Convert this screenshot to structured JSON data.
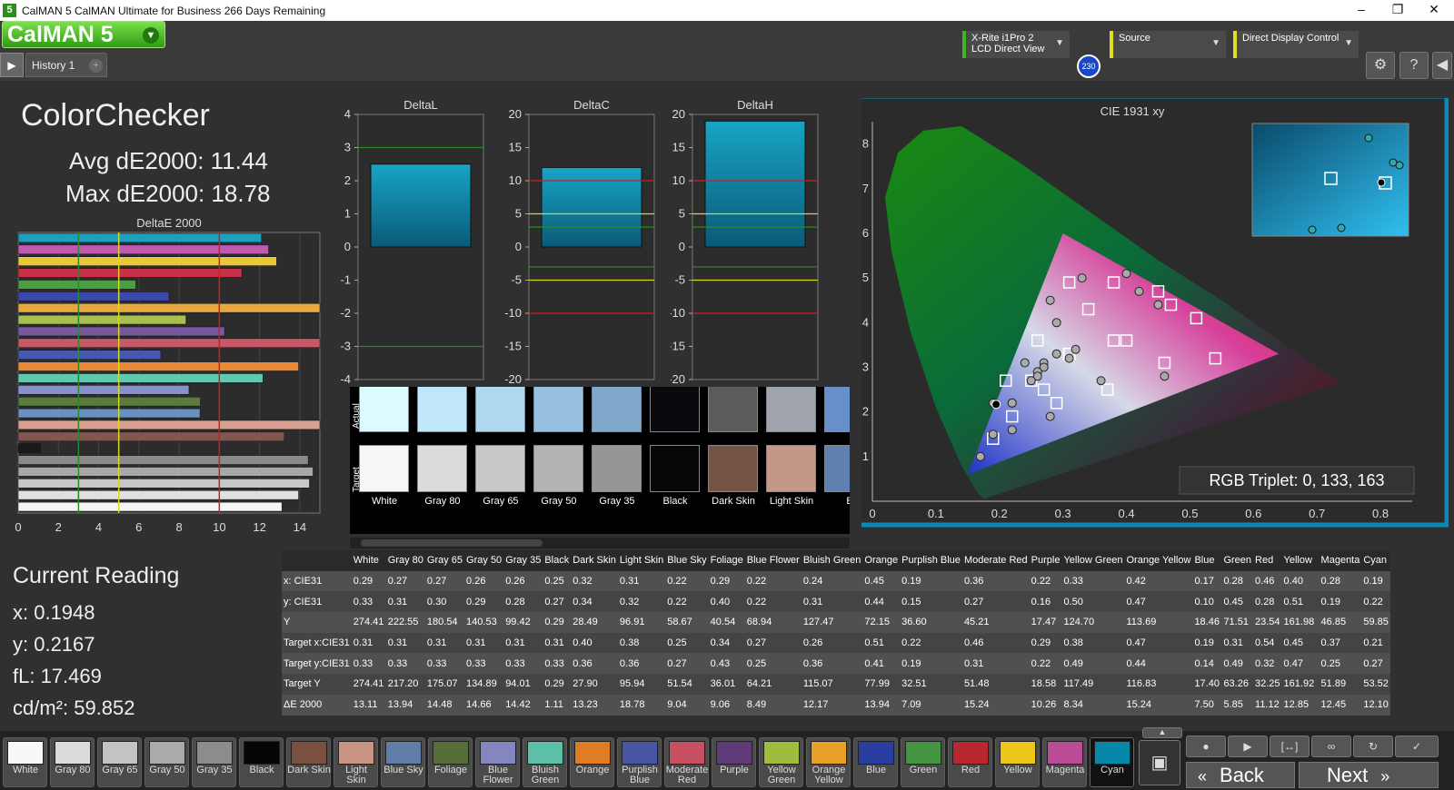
{
  "window": {
    "title": "CalMAN 5 CalMAN Ultimate for Business 266 Days Remaining",
    "icon_label": "5",
    "minimize": "–",
    "maximize": "❐",
    "close": "✕"
  },
  "header": {
    "logo": "CalMAN 5",
    "history_tab": "History 1",
    "meter_line1": "X-Rite i1Pro 2",
    "meter_line2": "LCD Direct View",
    "meter_badge": "230",
    "source": "Source",
    "display": "Direct Display Control",
    "colors": {
      "accent_green": "#3fb51f",
      "status_yellow": "#dede1e",
      "badge_blue": "#1848c8"
    }
  },
  "summary": {
    "title": "ColorChecker",
    "avg": "Avg dE2000: 11.44",
    "max": "Max dE2000: 18.78"
  },
  "current": {
    "title": "Current Reading",
    "x": "x: 0.1948",
    "y": "y: 0.2167",
    "fl": "fL: 17.469",
    "cd": "cd/m²: 59.852"
  },
  "chart_data": [
    {
      "type": "bar",
      "title": "DeltaE 2000",
      "orientation": "horizontal",
      "xlim": [
        0,
        15
      ],
      "xticks": [
        "0",
        "2",
        "4",
        "6",
        "8",
        "10",
        "12",
        "14"
      ],
      "thresholds": [
        {
          "value": 3,
          "color": "#2a8a2a"
        },
        {
          "value": 5,
          "color": "#d8d820"
        },
        {
          "value": 10,
          "color": "#c82020"
        }
      ],
      "categories": [
        "Cyan",
        "Magenta",
        "Yellow",
        "Red",
        "Green",
        "Blue",
        "Yellow Orange",
        "Yellow Green",
        "Purple",
        "Moderate Red",
        "Purplish Blue",
        "Orange",
        "Bluish Green",
        "Blue Flower",
        "Foliage",
        "Blue Sky",
        "Light Skin",
        "Dark Skin",
        "Black",
        "Gray 35",
        "Gray 50",
        "Gray 65",
        "Gray 80",
        "White"
      ],
      "values": [
        12.1,
        12.45,
        12.85,
        11.12,
        5.85,
        7.5,
        15.24,
        8.34,
        10.26,
        15.24,
        7.09,
        13.94,
        12.17,
        8.49,
        9.06,
        9.04,
        18.78,
        13.23,
        1.11,
        14.42,
        14.66,
        14.48,
        13.94,
        13.11
      ],
      "colors": [
        "#1aa0c0",
        "#c05ab0",
        "#e8c83a",
        "#c83048",
        "#4aa040",
        "#3a48a8",
        "#e8a840",
        "#a8c050",
        "#7a58a0",
        "#c85868",
        "#4858b0",
        "#e88838",
        "#60c8b0",
        "#8890d0",
        "#5a7a40",
        "#6890c0",
        "#d8a090",
        "#805850",
        "#1a1a1a",
        "#8a8a8a",
        "#a8a8a8",
        "#c8c8c8",
        "#e0e0e0",
        "#f5f5f5"
      ]
    },
    {
      "type": "bar",
      "title": "DeltaL",
      "ylim": [
        -4,
        4
      ],
      "yticks": [
        "4",
        "3",
        "2",
        "1",
        "0",
        "-1",
        "-2",
        "-3",
        "-4"
      ],
      "value": 2.5,
      "thresholds": [
        3,
        -3
      ]
    },
    {
      "type": "bar",
      "title": "DeltaC",
      "ylim": [
        -20,
        20
      ],
      "yticks": [
        "20",
        "15",
        "10",
        "5",
        "0",
        "-5",
        "-10",
        "-15",
        "-20"
      ],
      "value": 12,
      "thresholds": [
        10,
        5,
        3,
        -3,
        -5,
        -10
      ]
    },
    {
      "type": "bar",
      "title": "DeltaH",
      "ylim": [
        -20,
        20
      ],
      "yticks": [
        "20",
        "15",
        "10",
        "5",
        "0",
        "-5",
        "-10",
        "-15",
        "-20"
      ],
      "value": 19,
      "thresholds": [
        10,
        5,
        3,
        -3,
        -5,
        -10
      ]
    },
    {
      "type": "scatter",
      "title": "CIE 1931 xy",
      "xlim": [
        0,
        0.85
      ],
      "ylim": [
        0,
        0.85
      ],
      "xticks": [
        "0",
        "0.1",
        "0.2",
        "0.3",
        "0.4",
        "0.5",
        "0.6",
        "0.7",
        "0.8"
      ],
      "yticks": [
        "0",
        "0.1",
        "0.2",
        "0.3",
        "0.4",
        "0.5",
        "0.6",
        "0.7",
        "0.8"
      ],
      "gamut": [
        [
          0.64,
          0.33
        ],
        [
          0.3,
          0.6
        ],
        [
          0.15,
          0.06
        ]
      ],
      "actual_x": [
        0.29,
        0.27,
        0.27,
        0.26,
        0.26,
        0.25,
        0.32,
        0.31,
        0.22,
        0.29,
        0.22,
        0.24,
        0.45,
        0.19,
        0.36,
        0.22,
        0.33,
        0.42,
        0.17,
        0.28,
        0.46,
        0.4,
        0.28,
        0.19
      ],
      "actual_y": [
        0.33,
        0.31,
        0.3,
        0.29,
        0.28,
        0.27,
        0.34,
        0.32,
        0.22,
        0.4,
        0.22,
        0.31,
        0.44,
        0.15,
        0.27,
        0.16,
        0.5,
        0.47,
        0.1,
        0.45,
        0.28,
        0.51,
        0.19,
        0.22
      ],
      "target_x": [
        0.31,
        0.31,
        0.31,
        0.31,
        0.31,
        0.31,
        0.4,
        0.38,
        0.25,
        0.34,
        0.27,
        0.26,
        0.51,
        0.22,
        0.46,
        0.29,
        0.38,
        0.47,
        0.19,
        0.31,
        0.54,
        0.45,
        0.37,
        0.21
      ],
      "target_y": [
        0.33,
        0.33,
        0.33,
        0.33,
        0.33,
        0.33,
        0.36,
        0.36,
        0.27,
        0.43,
        0.25,
        0.36,
        0.41,
        0.19,
        0.31,
        0.22,
        0.49,
        0.44,
        0.14,
        0.49,
        0.32,
        0.47,
        0.25,
        0.27
      ],
      "current": [
        0.1948,
        0.2167
      ]
    }
  ],
  "rgb_triplet": "RGB Triplet: 0, 133, 163",
  "swatch_panel": {
    "actual_label": "Actual",
    "target_label": "Target",
    "items": [
      {
        "name": "White",
        "actual": "#dcfaff",
        "target": "#f6f6f6"
      },
      {
        "name": "Gray 80",
        "actual": "#c0e6fa",
        "target": "#dcdcdc"
      },
      {
        "name": "Gray 65",
        "actual": "#b0d8f0",
        "target": "#c8c8c8"
      },
      {
        "name": "Gray 50",
        "actual": "#98c0e0",
        "target": "#b4b4b4"
      },
      {
        "name": "Gray 35",
        "actual": "#80a8cc",
        "target": "#969696"
      },
      {
        "name": "Black",
        "actual": "#080a0e",
        "target": "#060606"
      },
      {
        "name": "Dark Skin",
        "actual": "#5c5a5a",
        "target": "#745444"
      },
      {
        "name": "Light Skin",
        "actual": "#a0a4ac",
        "target": "#c49888"
      },
      {
        "name": "B",
        "actual": "#6890c8",
        "target": "#6080b0"
      }
    ]
  },
  "table": {
    "columns": [
      "",
      "White",
      "Gray 80",
      "Gray 65",
      "Gray 50",
      "Gray 35",
      "Black",
      "Dark Skin",
      "Light Skin",
      "Blue Sky",
      "Foliage",
      "Blue Flower",
      "Bluish Green",
      "Orange",
      "Purplish Blue",
      "Moderate Red",
      "Purple",
      "Yellow Green",
      "Orange Yellow",
      "Blue",
      "Green",
      "Red",
      "Yellow",
      "Magenta",
      "Cyan"
    ],
    "rows": [
      [
        "x: CIE31",
        "0.29",
        "0.27",
        "0.27",
        "0.26",
        "0.26",
        "0.25",
        "0.32",
        "0.31",
        "0.22",
        "0.29",
        "0.22",
        "0.24",
        "0.45",
        "0.19",
        "0.36",
        "0.22",
        "0.33",
        "0.42",
        "0.17",
        "0.28",
        "0.46",
        "0.40",
        "0.28",
        "0.19"
      ],
      [
        "y: CIE31",
        "0.33",
        "0.31",
        "0.30",
        "0.29",
        "0.28",
        "0.27",
        "0.34",
        "0.32",
        "0.22",
        "0.40",
        "0.22",
        "0.31",
        "0.44",
        "0.15",
        "0.27",
        "0.16",
        "0.50",
        "0.47",
        "0.10",
        "0.45",
        "0.28",
        "0.51",
        "0.19",
        "0.22"
      ],
      [
        "Y",
        "274.41",
        "222.55",
        "180.54",
        "140.53",
        "99.42",
        "0.29",
        "28.49",
        "96.91",
        "58.67",
        "40.54",
        "68.94",
        "127.47",
        "72.15",
        "36.60",
        "45.21",
        "17.47",
        "124.70",
        "113.69",
        "18.46",
        "71.51",
        "23.54",
        "161.98",
        "46.85",
        "59.85"
      ],
      [
        "Target x:CIE31",
        "0.31",
        "0.31",
        "0.31",
        "0.31",
        "0.31",
        "0.31",
        "0.40",
        "0.38",
        "0.25",
        "0.34",
        "0.27",
        "0.26",
        "0.51",
        "0.22",
        "0.46",
        "0.29",
        "0.38",
        "0.47",
        "0.19",
        "0.31",
        "0.54",
        "0.45",
        "0.37",
        "0.21"
      ],
      [
        "Target y:CIE31",
        "0.33",
        "0.33",
        "0.33",
        "0.33",
        "0.33",
        "0.33",
        "0.36",
        "0.36",
        "0.27",
        "0.43",
        "0.25",
        "0.36",
        "0.41",
        "0.19",
        "0.31",
        "0.22",
        "0.49",
        "0.44",
        "0.14",
        "0.49",
        "0.32",
        "0.47",
        "0.25",
        "0.27"
      ],
      [
        "Target Y",
        "274.41",
        "217.20",
        "175.07",
        "134.89",
        "94.01",
        "0.29",
        "27.90",
        "95.94",
        "51.54",
        "36.01",
        "64.21",
        "115.07",
        "77.99",
        "32.51",
        "51.48",
        "18.58",
        "117.49",
        "116.83",
        "17.40",
        "63.26",
        "32.25",
        "161.92",
        "51.89",
        "53.52"
      ],
      [
        "ΔE 2000",
        "13.11",
        "13.94",
        "14.48",
        "14.66",
        "14.42",
        "1.11",
        "13.23",
        "18.78",
        "9.04",
        "9.06",
        "8.49",
        "12.17",
        "13.94",
        "7.09",
        "15.24",
        "10.26",
        "8.34",
        "15.24",
        "7.50",
        "5.85",
        "11.12",
        "12.85",
        "12.45",
        "12.10"
      ]
    ]
  },
  "patch_buttons": [
    {
      "label": "White",
      "color": "#f8f8f8"
    },
    {
      "label": "Gray 80",
      "color": "#dcdcdc"
    },
    {
      "label": "Gray 65",
      "color": "#c4c4c4"
    },
    {
      "label": "Gray 50",
      "color": "#aaaaaa"
    },
    {
      "label": "Gray 35",
      "color": "#8c8c8c"
    },
    {
      "label": "Black",
      "color": "#050505"
    },
    {
      "label": "Dark Skin",
      "color": "#7a5040"
    },
    {
      "label": "Light Skin",
      "color": "#c89484"
    },
    {
      "label": "Blue Sky",
      "color": "#5e7ea8"
    },
    {
      "label": "Foliage",
      "color": "#566e3a"
    },
    {
      "label": "Blue Flower",
      "color": "#8486c0"
    },
    {
      "label": "Bluish Green",
      "color": "#5cc0a8"
    },
    {
      "label": "Orange",
      "color": "#e07c24"
    },
    {
      "label": "Purplish Blue",
      "color": "#4656a4"
    },
    {
      "label": "Moderate Red",
      "color": "#c85062"
    },
    {
      "label": "Purple",
      "color": "#5e3a78"
    },
    {
      "label": "Yellow Green",
      "color": "#a0bc3c"
    },
    {
      "label": "Orange Yellow",
      "color": "#e8a028"
    },
    {
      "label": "Blue",
      "color": "#283ea0"
    },
    {
      "label": "Green",
      "color": "#449440"
    },
    {
      "label": "Red",
      "color": "#b82830"
    },
    {
      "label": "Yellow",
      "color": "#ecc618"
    },
    {
      "label": "Magenta",
      "color": "#bc4c98"
    },
    {
      "label": "Cyan",
      "color": "#0888a8"
    }
  ],
  "nav": {
    "back": "Back",
    "next": "Next",
    "back_icon": "«",
    "next_icon": "»"
  }
}
